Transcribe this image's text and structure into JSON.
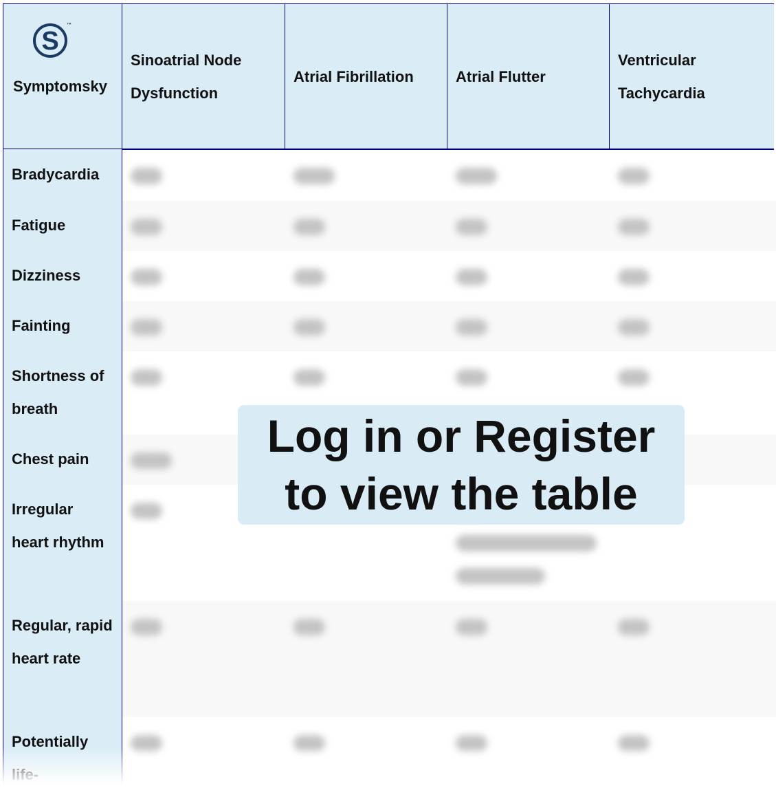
{
  "header": {
    "brand": "Symptomsky",
    "logo_letter": "S",
    "logo_tm": "™",
    "columns": [
      "Sinoatrial Node Dysfunction",
      "Atrial Fibrillation",
      "Atrial Flutter",
      "Ventricular Tachycardia"
    ]
  },
  "rows": [
    "Bradycardia",
    "Fatigue",
    "Dizziness",
    "Fainting",
    "Shortness of breath",
    "Chest pain",
    "Irregular heart rhythm",
    "Regular, rapid heart rate",
    "Potentially life-"
  ],
  "overlay": {
    "line1": "Log in or Register",
    "line2": "to view the table"
  },
  "colors": {
    "header_bg": "#daecf6",
    "border": "#000080",
    "logo": "#1b3a63"
  }
}
